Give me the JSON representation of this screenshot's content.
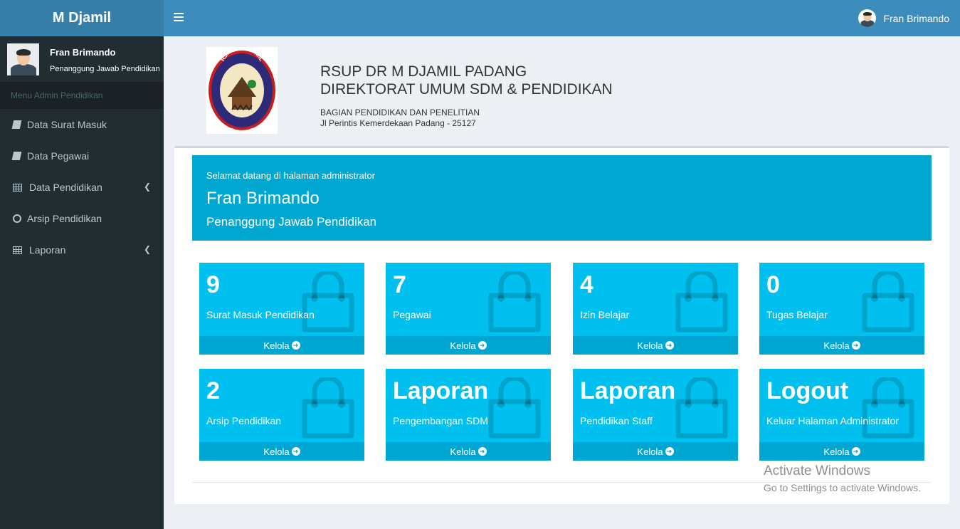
{
  "app": {
    "title": "M Djamil"
  },
  "topbar": {
    "user_name": "Fran Brimando"
  },
  "sidebar": {
    "user": {
      "name": "Fran Brimando",
      "role": "Penanggung Jawab Pendidikan"
    },
    "menu_header": "Menu Admin Pendidikan",
    "items": [
      {
        "label": "Data Surat Masuk",
        "icon": "book-icon"
      },
      {
        "label": "Data Pegawai",
        "icon": "book-icon"
      },
      {
        "label": "Data Pendidikan",
        "icon": "table-icon",
        "submenu": true
      },
      {
        "label": "Arsip Pendidikan",
        "icon": "circle-icon"
      },
      {
        "label": "Laporan",
        "icon": "table-icon",
        "submenu": true
      }
    ]
  },
  "header": {
    "logo_text_top": "RS.DR.M.DJAMIL",
    "logo_text_bottom": "PADANG 1953",
    "line1": "RSUP DR M DJAMIL PADANG",
    "line2": "DIREKTORAT UMUM SDM & PENDIDIKAN",
    "line3": "BAGIAN PENDIDIKAN DAN PENELITIAN",
    "line4": "Jl Perintis Kemerdekaan Padang - 25127"
  },
  "welcome": {
    "line1": "Selamat datang di halaman administrator",
    "name": "Fran Brimando",
    "role": "Penanggung Jawab Pendidikan"
  },
  "tiles": [
    {
      "value": "9",
      "label": "Surat Masuk Pendidikan",
      "link": "Kelola"
    },
    {
      "value": "7",
      "label": "Pegawai",
      "link": "Kelola"
    },
    {
      "value": "4",
      "label": "Izin Belajar",
      "link": "Kelola"
    },
    {
      "value": "0",
      "label": "Tugas Belajar",
      "link": "Kelola"
    },
    {
      "value": "2",
      "label": "Arsip Pendidikan",
      "link": "Kelola"
    },
    {
      "value": "Laporan",
      "label": "Pengembangan SDM",
      "link": "Kelola"
    },
    {
      "value": "Laporan",
      "label": "Pendidikan Staff",
      "link": "Kelola"
    },
    {
      "value": "Logout",
      "label": "Keluar Halaman Administrator",
      "link": "Kelola"
    }
  ],
  "watermark": {
    "line1": "Activate Windows",
    "line2": "Go to Settings to activate Windows."
  },
  "colors": {
    "topbar": "#3c8dbc",
    "logo_bg": "#367fa9",
    "sidebar": "#222d32",
    "tile": "#00c0ef",
    "callout": "#00a7d0"
  }
}
